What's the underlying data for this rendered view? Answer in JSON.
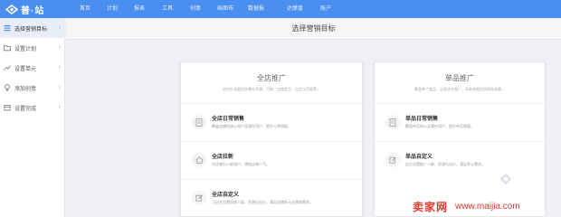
{
  "brand": {
    "logo_text": "普·站"
  },
  "nav": [
    "首页",
    "计划",
    "报表",
    "工具",
    "创意",
    "画图布",
    "数据报",
    "达摩盘",
    "账户"
  ],
  "sidebar": {
    "items": [
      {
        "label": "选择营销目标",
        "icon": "list-icon",
        "active": true
      },
      {
        "label": "设置计划",
        "icon": "folder-icon",
        "active": false
      },
      {
        "label": "设置单元",
        "icon": "chart-icon",
        "active": false
      },
      {
        "label": "添加创意",
        "icon": "bulb-icon",
        "active": false
      },
      {
        "label": "设置完成",
        "icon": "box-icon",
        "active": false
      }
    ]
  },
  "page": {
    "title": "选择营销目标"
  },
  "cards": [
    {
      "title": "全店推广",
      "desc": "站内外海量优质曝光资源，可推广店铺首页、自定义页面等。",
      "options": [
        {
          "title": "全店日常销售",
          "desc": "覆盖店铺的核心用户及潜在用户，提升日常销量。",
          "icon": "doc-icon"
        },
        {
          "title": "全店拉新",
          "desc": "为店铺引入新用户，增加店铺人气。",
          "icon": "house-icon"
        },
        {
          "title": "全店自定义",
          "desc": "可自主设置投放人群、资源位出价，满足店铺多元化营销需求。",
          "icon": "edit-icon"
        }
      ]
    },
    {
      "title": "单品推广",
      "desc": "覆盖单个商品，全面优化推广，获取海量优质精准流量。",
      "options": [
        {
          "title": "单品日常销售",
          "desc": "覆盖单品核心及潜在用户，提升单品销量。",
          "icon": "doc-icon"
        },
        {
          "title": "单品自定义",
          "desc": "自主设置推广人群、资源位出价，满足多元需求。",
          "icon": "edit-icon"
        }
      ]
    }
  ],
  "watermark": {
    "main": "卖家网",
    "url": "www.maijia.com"
  },
  "colors": {
    "topbar": "#4a8ef0",
    "accent": "#e03a2f"
  }
}
